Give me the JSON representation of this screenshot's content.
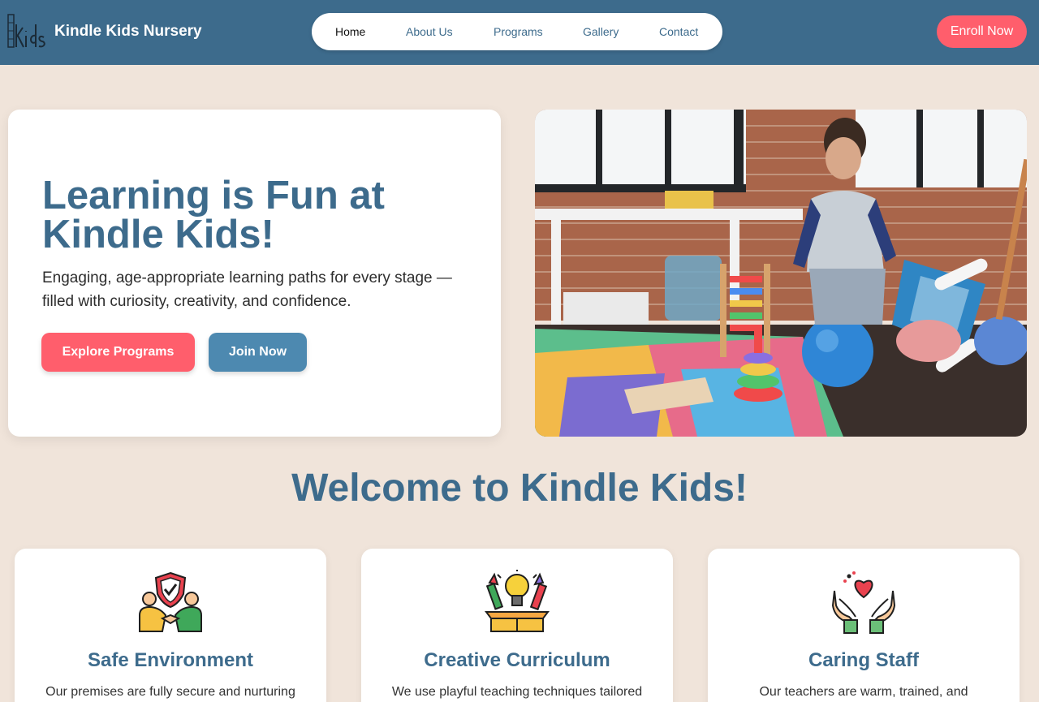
{
  "header": {
    "brand": "Kindle Kids Nursery",
    "nav": [
      "Home",
      "About Us",
      "Programs",
      "Gallery",
      "Contact"
    ],
    "active_nav": "Home",
    "enroll_label": "Enroll Now"
  },
  "hero": {
    "title": "Learning is Fun at Kindle Kids!",
    "subtitle": "Engaging, age-appropriate learning paths for every stage — filled with curiosity, creativity, and confidence.",
    "primary_button": "Explore Programs",
    "secondary_button": "Join Now"
  },
  "welcome": {
    "heading": "Welcome to Kindle Kids!"
  },
  "features": [
    {
      "title": "Safe Environment",
      "text": "Our premises are fully secure and nurturing",
      "icon": "safety-shield-icon"
    },
    {
      "title": "Creative Curriculum",
      "text": "We use playful teaching techniques tailored",
      "icon": "lightbulb-crayons-icon"
    },
    {
      "title": "Caring Staff",
      "text": "Our teachers are warm, trained, and",
      "icon": "caring-hands-heart-icon"
    }
  ],
  "colors": {
    "primary": "#3d6b8c",
    "accent": "#ff5e6c",
    "secondary_button": "#4d89b0",
    "page_background": "#f0e4da"
  }
}
